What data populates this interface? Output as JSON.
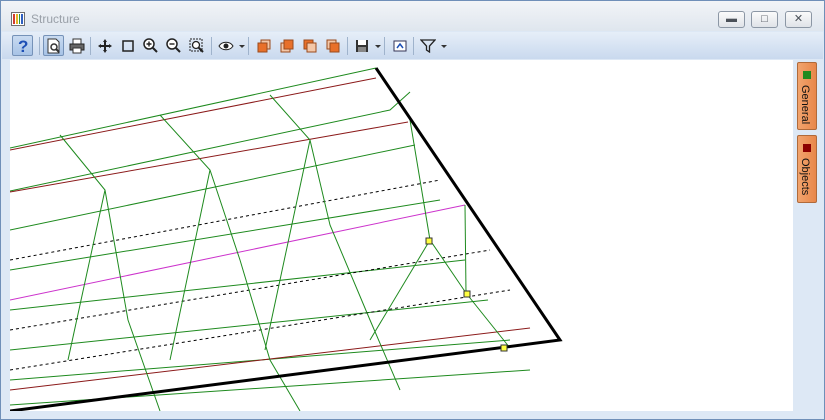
{
  "window": {
    "title": "Structure",
    "icon": "app-structure-icon",
    "controls": [
      "minimize-icon",
      "maximize-icon",
      "close-icon"
    ]
  },
  "toolbar": {
    "buttons": [
      "help-icon",
      "print-preview-icon",
      "print-icon",
      "pan-icon",
      "select-rectangle-icon",
      "zoom-in-icon",
      "zoom-out-icon",
      "zoom-fit-icon",
      "view-eye-icon",
      "view-front-icon",
      "view-back-icon",
      "view-side-icon",
      "view-top-icon",
      "save-image-icon",
      "refresh-view-icon",
      "filter-icon"
    ]
  },
  "side_tabs": [
    {
      "label": "General",
      "color": "#1f8a1f"
    },
    {
      "label": "Objects",
      "color": "#8b0000"
    }
  ],
  "colors": {
    "mesh": "#1e8a1e",
    "red_line": "#8b1a1a",
    "magenta_line": "#cc33cc",
    "edge": "#000000",
    "node": "#ffff40"
  }
}
